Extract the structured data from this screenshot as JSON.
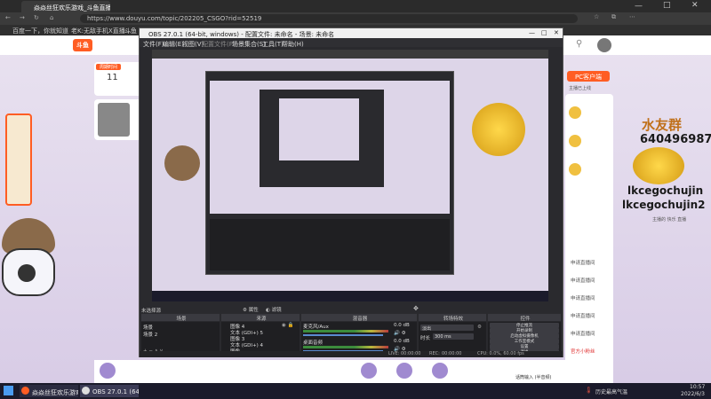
{
  "browser": {
    "tab_title": "焱焱丝狂欢乐游戏_斗鱼直播平台",
    "url": "https://www.douyu.com/topic/202205_CSGO?rid=52519",
    "bookmarks": [
      "百度一下，你就知道",
      "老K:无敌手机X直播...",
      "斗鱼 -"
    ]
  },
  "page": {
    "left_date_label": "周期时间",
    "left_date_day": "11",
    "right_user_line1": "水友群",
    "right_user_id": "640496987",
    "right_name1": "lkcegochujin",
    "right_name2": "lkcegochujin2",
    "right_small": "主播的 快乐 直播",
    "right_links": [
      "PC客户端",
      "主播已上线"
    ],
    "right_list": [
      "申请直播间",
      "申请直播间",
      "申请直播间",
      "申请直播间",
      "申请直播间",
      "官方小粉丝"
    ],
    "bottom_text": "话筒输入 (半音频)"
  },
  "obs": {
    "title": "OBS 27.0.1 (64-bit, windows) - 配置文件: 未命名 - 场景: 未命名",
    "menu": [
      "文件(F)",
      "编辑(E)",
      "视图(V)",
      "配置文件(P)",
      "场景集合(S)",
      "工具(T)",
      "帮助(H)"
    ],
    "toolbar_label": "未选择源",
    "props_button": "属性",
    "filters_button": "滤镜",
    "scenes_header": "场景",
    "sources_header": "来源",
    "mixer_header": "混音器",
    "transitions_header": "转场特效",
    "controls_header": "控件",
    "scenes": [
      "场景",
      "场景 2"
    ],
    "sources": [
      "图像 4",
      "文本 (GDI+) 5",
      "图像 3",
      "文本 (GDI+) 4",
      "图像"
    ],
    "mixer": [
      {
        "name": "麦克风/Aux",
        "db": "0.0 dB"
      },
      {
        "name": "桌面音频",
        "db": "0.0 dB"
      }
    ],
    "transition": "淡出",
    "duration_label": "时长",
    "duration": "300 ms",
    "controls": [
      "停止推流",
      "开始录制",
      "启动虚拟摄像机",
      "工作室模式",
      "设置",
      "退出"
    ],
    "status": {
      "live_label": "LIVE:",
      "live_time": "00:00:00",
      "rec_label": "REC:",
      "rec_time": "00:00:00",
      "cpu": "CPU: 0.0%, 60.00 fps"
    }
  },
  "taskbar": {
    "items": [
      "焱焱丝狂欢乐游戏_...",
      "OBS 27.0.1 (64-bi..."
    ],
    "weather": "历史最高气温",
    "time": "10:57",
    "date": "2022/6/3"
  },
  "colors": {
    "accent": "#ff5d23",
    "obs_bg": "#2a2a2e",
    "page_bg": "#e3d9ee",
    "taskbar": "#1b1b2b"
  }
}
